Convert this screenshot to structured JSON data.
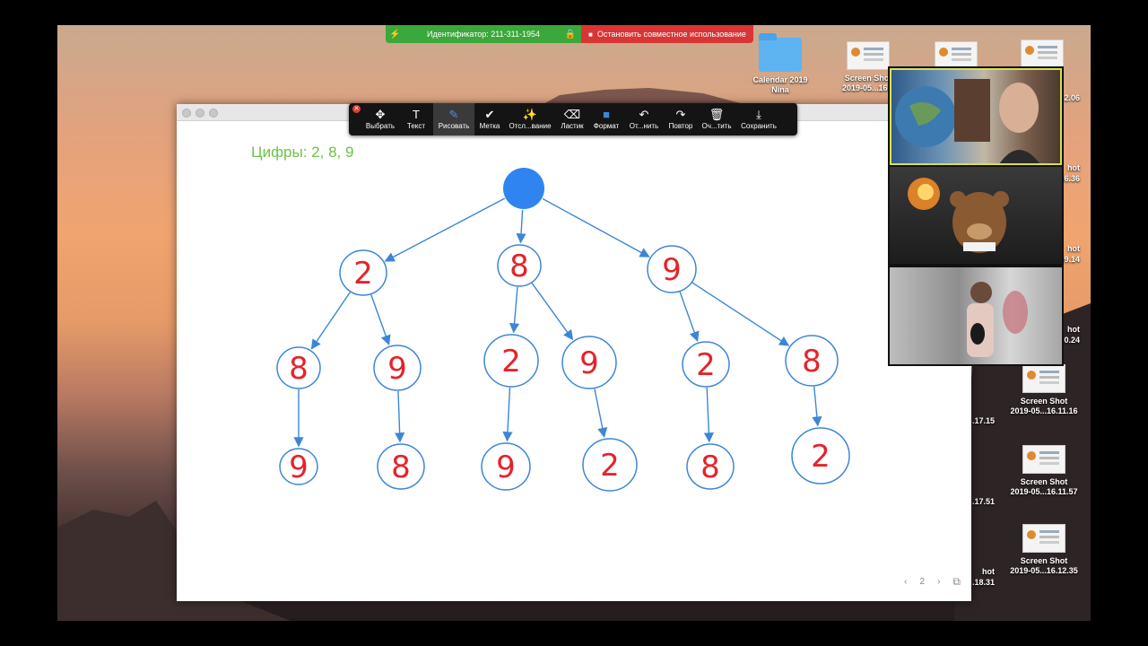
{
  "meeting": {
    "id_label": "Идентификатор: 211-311-1954",
    "stop_label": "Остановить совместное использование"
  },
  "desktop": {
    "icons": [
      {
        "name": "Calendar 2019",
        "sub": "Nina",
        "kind": "folder"
      },
      {
        "name": "Screen Shot",
        "sub": "2019-05...16.1",
        "kind": "thumb"
      },
      {
        "name": "",
        "sub": "",
        "kind": "thumb"
      },
      {
        "name": "",
        "sub": "",
        "kind": "thumb"
      }
    ],
    "right_column": [
      {
        "name": "Screen Shot",
        "sub": "2019-05...16.11.16"
      },
      {
        "name": "Screen Shot",
        "sub": "2019-05...16.11.57"
      },
      {
        "name": "Screen Shot",
        "sub": "2019-05...16.12.35"
      }
    ],
    "partial_labels": [
      "2.06",
      "hot",
      "06.36",
      "hot",
      "09.14",
      "hot",
      "0.24",
      ".17.15",
      ".17.51",
      "hot",
      ".18.31"
    ]
  },
  "toolbar": {
    "tools": [
      {
        "label": "Выбрать",
        "icon": "✥"
      },
      {
        "label": "Текст",
        "icon": "T"
      },
      {
        "label": "Рисовать",
        "icon": "✎",
        "active": true
      },
      {
        "label": "Метка",
        "icon": "✔"
      },
      {
        "label": "Отсл...вание",
        "icon": "✨"
      },
      {
        "label": "Ластик",
        "icon": "⌫"
      },
      {
        "label": "Формат",
        "icon": "■"
      },
      {
        "label": "От...нить",
        "icon": "↶"
      },
      {
        "label": "Повтор",
        "icon": "↷"
      },
      {
        "label": "Оч...тить",
        "icon": "🗑"
      },
      {
        "label": "Сохранить",
        "icon": "⤓"
      }
    ]
  },
  "whiteboard": {
    "heading": "Цифры: 2, 8, 9",
    "level1": [
      "2",
      "8",
      "9"
    ],
    "level2": [
      "8",
      "9",
      "2",
      "9",
      "2",
      "8"
    ],
    "level3": [
      "9",
      "8",
      "9",
      "2",
      "8",
      "2"
    ],
    "page": "2"
  },
  "colors": {
    "accent": "#3d86d6",
    "digits": "#e5232b",
    "heading": "#6cc24a",
    "root": "#2f84f0"
  }
}
